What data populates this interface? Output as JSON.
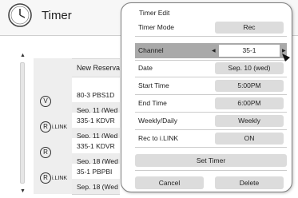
{
  "background": {
    "title": "Timer",
    "new_reservation": "New Reserva",
    "rows": [
      {
        "mode_letter": "V",
        "ilink": "",
        "line1": "80-3  PBS1D",
        "line2": "Sep. 11 (Wed"
      },
      {
        "mode_letter": "R",
        "ilink": "i.LINK",
        "line1": "335-1  KDVR",
        "line2": "Sep. 11 (Wed"
      },
      {
        "mode_letter": "R",
        "ilink": "",
        "line1": "335-1  KDVR",
        "line2": "Sep. 18 (Wed"
      },
      {
        "mode_letter": "R",
        "ilink": "i.LINK",
        "line1": "35-1  PBPBI",
        "line2": "Sep. 18 (Wed"
      }
    ]
  },
  "popup": {
    "title": "Timer Edit",
    "fields": {
      "timer_mode": {
        "label": "Timer Mode",
        "value": "Rec"
      },
      "channel": {
        "label": "Channel",
        "value": "35-1"
      },
      "date": {
        "label": "Date",
        "value": "Sep. 10 (wed)"
      },
      "start_time": {
        "label": "Start Time",
        "value": "5:00PM"
      },
      "end_time": {
        "label": "End Time",
        "value": "6:00PM"
      },
      "weekly_daily": {
        "label": "Weekly/Daily",
        "value": "Weekly"
      },
      "rec_to_ilink": {
        "label": "Rec to i.LINK",
        "value": "ON"
      }
    },
    "set_timer_label": "Set Timer",
    "cancel_label": "Cancel",
    "delete_label": "Delete"
  }
}
